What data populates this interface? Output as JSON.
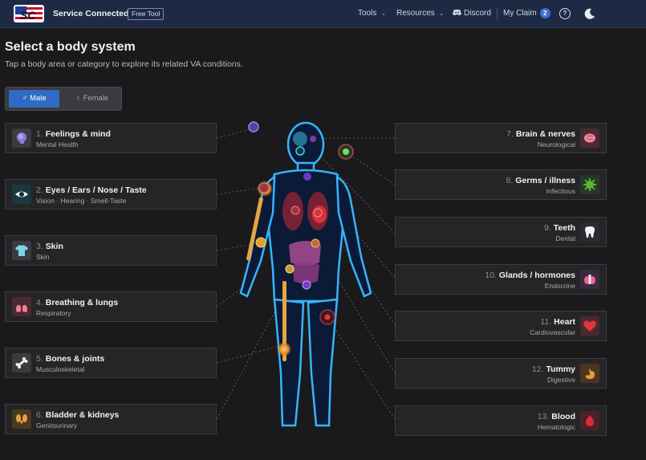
{
  "topbar": {
    "brand": "Service Connected",
    "tag": "Free Tool",
    "nav": {
      "tools": "Tools",
      "resources": "Resources",
      "discord": "Discord",
      "my_claim": "My Claim",
      "claim_count": "2"
    }
  },
  "page": {
    "title": "Select a body system",
    "subtitle": "Tap a body area or category to explore its related VA conditions."
  },
  "sex_toggle": {
    "male": "♂ Male",
    "female": "♀ Female",
    "selected": "male"
  },
  "categories": [
    {
      "num": "1.",
      "title": "Feelings & mind",
      "sub": "Mental Health",
      "icon": "head-icon"
    },
    {
      "num": "2.",
      "title": "Eyes / Ears / Nose / Taste",
      "sub": "Vision · Hearing · Smell-Taste",
      "icon": "eye-icon"
    },
    {
      "num": "3.",
      "title": "Skin",
      "sub": "Skin",
      "icon": "shirt-icon"
    },
    {
      "num": "4.",
      "title": "Breathing & lungs",
      "sub": "Respiratory",
      "icon": "lungs-icon"
    },
    {
      "num": "5.",
      "title": "Bones & joints",
      "sub": "Musculoskeletal",
      "icon": "bone-icon"
    },
    {
      "num": "6.",
      "title": "Bladder & kidneys",
      "sub": "Genitourinary",
      "icon": "kidneys-icon"
    },
    {
      "num": "7.",
      "title": "Brain & nerves",
      "sub": "Neurological",
      "icon": "brain-icon"
    },
    {
      "num": "8.",
      "title": "Germs / illness",
      "sub": "Infectious",
      "icon": "germ-icon"
    },
    {
      "num": "9.",
      "title": "Teeth",
      "sub": "Dental",
      "icon": "tooth-icon"
    },
    {
      "num": "10.",
      "title": "Glands / hormones",
      "sub": "Endocrine",
      "icon": "thyroid-icon"
    },
    {
      "num": "11.",
      "title": "Heart",
      "sub": "Cardiovascular",
      "icon": "heart-icon"
    },
    {
      "num": "12.",
      "title": "Tummy",
      "sub": "Digestive",
      "icon": "stomach-icon"
    },
    {
      "num": "13.",
      "title": "Blood",
      "sub": "Hematologic",
      "icon": "blood-drop-icon"
    }
  ],
  "colors": {
    "accent": "#2f6bc6",
    "topbar": "#1e2a44",
    "background": "#1a1a1c",
    "card": "#252527",
    "body_glow": "#2fa8ff"
  }
}
